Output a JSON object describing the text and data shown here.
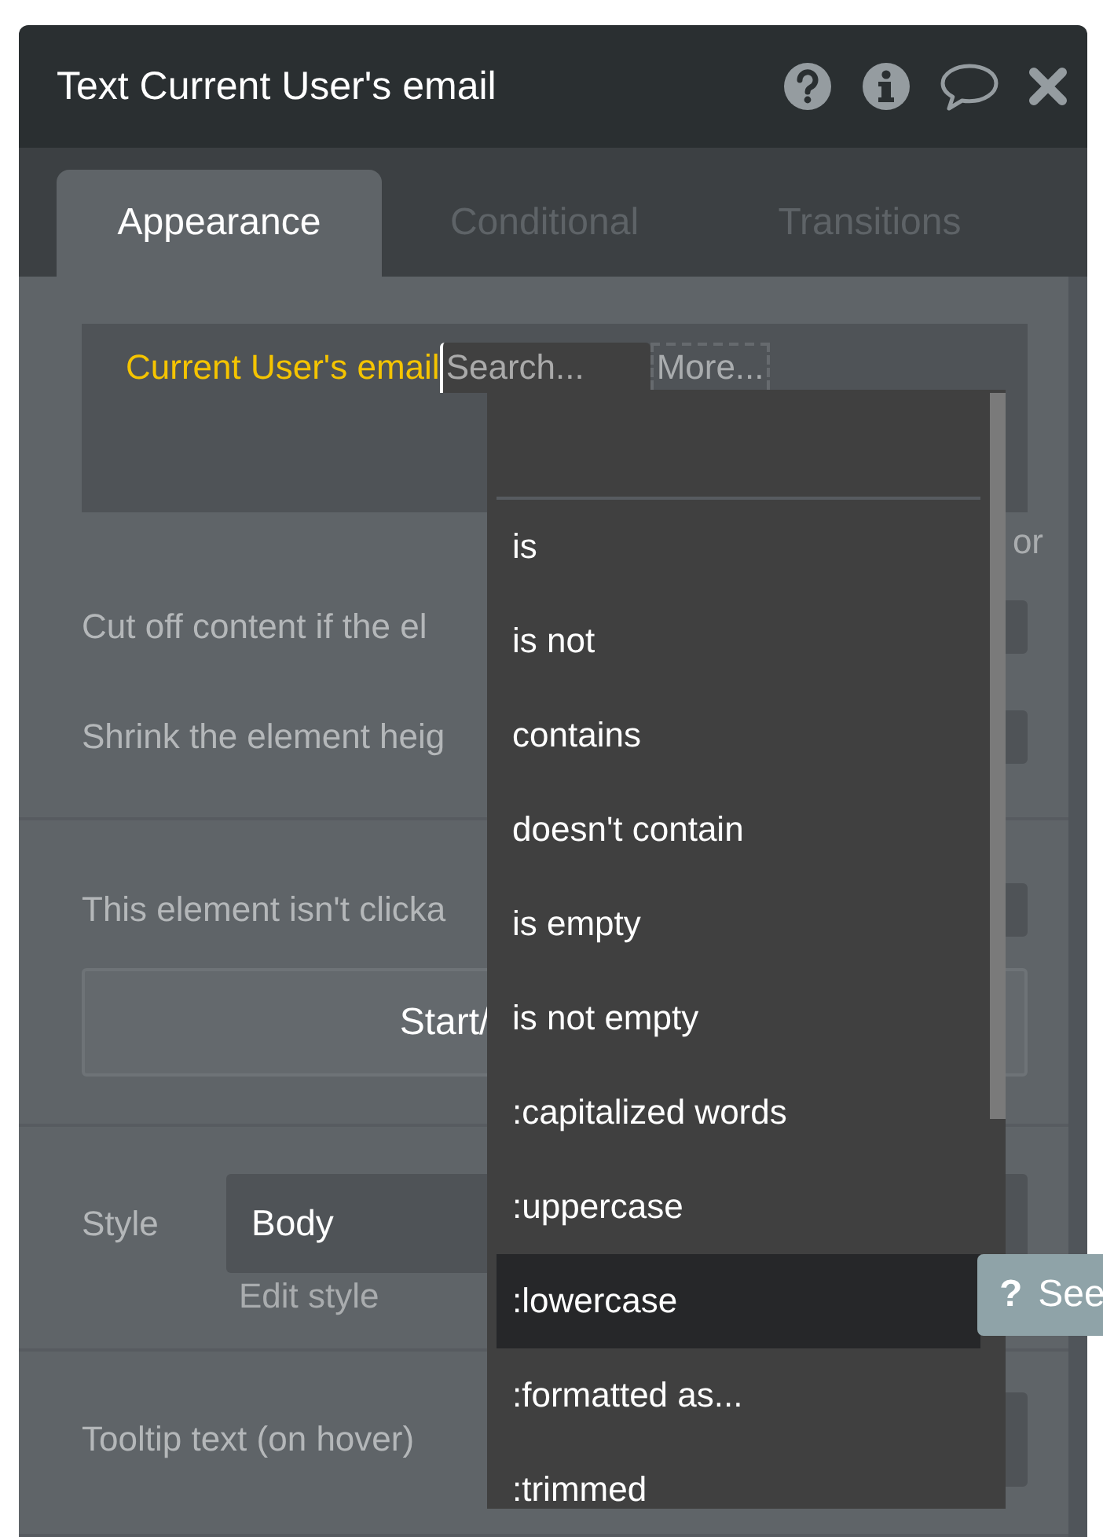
{
  "window": {
    "title": "Text Current User's email"
  },
  "tabs": [
    {
      "label": "Appearance",
      "selected": true
    },
    {
      "label": "Conditional",
      "selected": false
    },
    {
      "label": "Transitions",
      "selected": false
    }
  ],
  "expression": {
    "value": "Current User's email",
    "search": {
      "placeholder": "Search..."
    },
    "more": "More..."
  },
  "or_label": "or",
  "settings": [
    {
      "label": "Cut off content if the el",
      "checked": false
    },
    {
      "label": "Shrink the element heig",
      "checked": false
    },
    {
      "label": "This element isn't clicka",
      "checked": false
    }
  ],
  "workflow_button": "Start/",
  "style": {
    "label": "Style",
    "value": "Body",
    "edit_link": "Edit style"
  },
  "tooltip": {
    "label": "Tooltip text (on hover)"
  },
  "dropdown": {
    "items": [
      {
        "label": "is",
        "selected": false
      },
      {
        "label": "is not",
        "selected": false
      },
      {
        "label": "contains",
        "selected": false
      },
      {
        "label": "doesn't contain",
        "selected": false
      },
      {
        "label": "is empty",
        "selected": false
      },
      {
        "label": "is not empty",
        "selected": false
      },
      {
        "label": ":capitalized words",
        "selected": false
      },
      {
        "label": ":uppercase",
        "selected": false
      },
      {
        "label": ":lowercase",
        "selected": true
      },
      {
        "label": ":formatted as...",
        "selected": false
      },
      {
        "label": ":trimmed",
        "selected": false
      }
    ]
  },
  "help_button": {
    "icon": "?",
    "label": "See"
  }
}
